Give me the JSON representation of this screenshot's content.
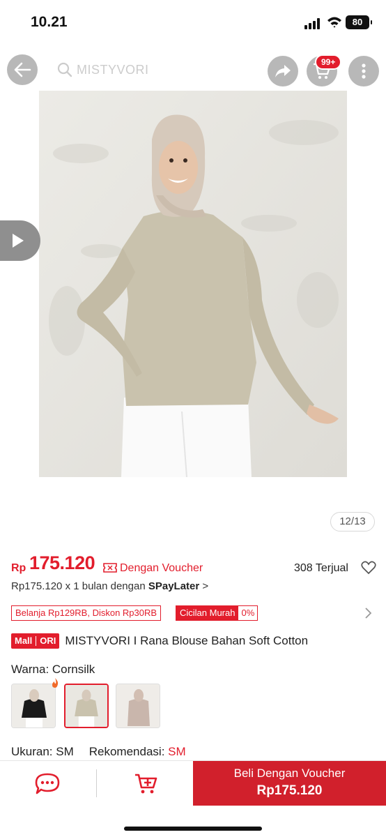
{
  "status_bar": {
    "time": "10.21",
    "battery": "80"
  },
  "header": {
    "search_placeholder": "MISTYVORI",
    "cart_badge": "99+",
    "icons": [
      "back-arrow-icon",
      "search-icon",
      "share-icon",
      "cart-icon",
      "more-vertical-icon"
    ]
  },
  "gallery": {
    "counter": "12/13"
  },
  "price": {
    "currency": "Rp",
    "amount": "175.120",
    "voucher_label": "Dengan Voucher",
    "sold": "308 Terjual",
    "paylater_prefix": "Rp175.120 x 1 bulan dengan ",
    "paylater_brand": "SPayLater",
    "paylater_arrow": ">"
  },
  "promo": {
    "tag1": "Belanja Rp129RB, Diskon Rp30RB",
    "tag2_label": "Cicilan Murah",
    "tag2_value": "0%"
  },
  "product": {
    "badge_mall": "Mall",
    "badge_ori": "ORI",
    "title": "MISTYVORI I Rana Blouse Bahan Soft Cotton"
  },
  "variant": {
    "label": "Warna: ",
    "selected": "Cornsilk",
    "size_label": "Ukuran: ",
    "size_value": "SM",
    "reco_label": "Rekomendasi: ",
    "reco_value": "SM"
  },
  "bottom_bar": {
    "buy_line1": "Beli Dengan Voucher",
    "buy_line2": "Rp175.120"
  },
  "colors": {
    "accent": "#e21d2c",
    "buy_button": "#d1202c"
  }
}
